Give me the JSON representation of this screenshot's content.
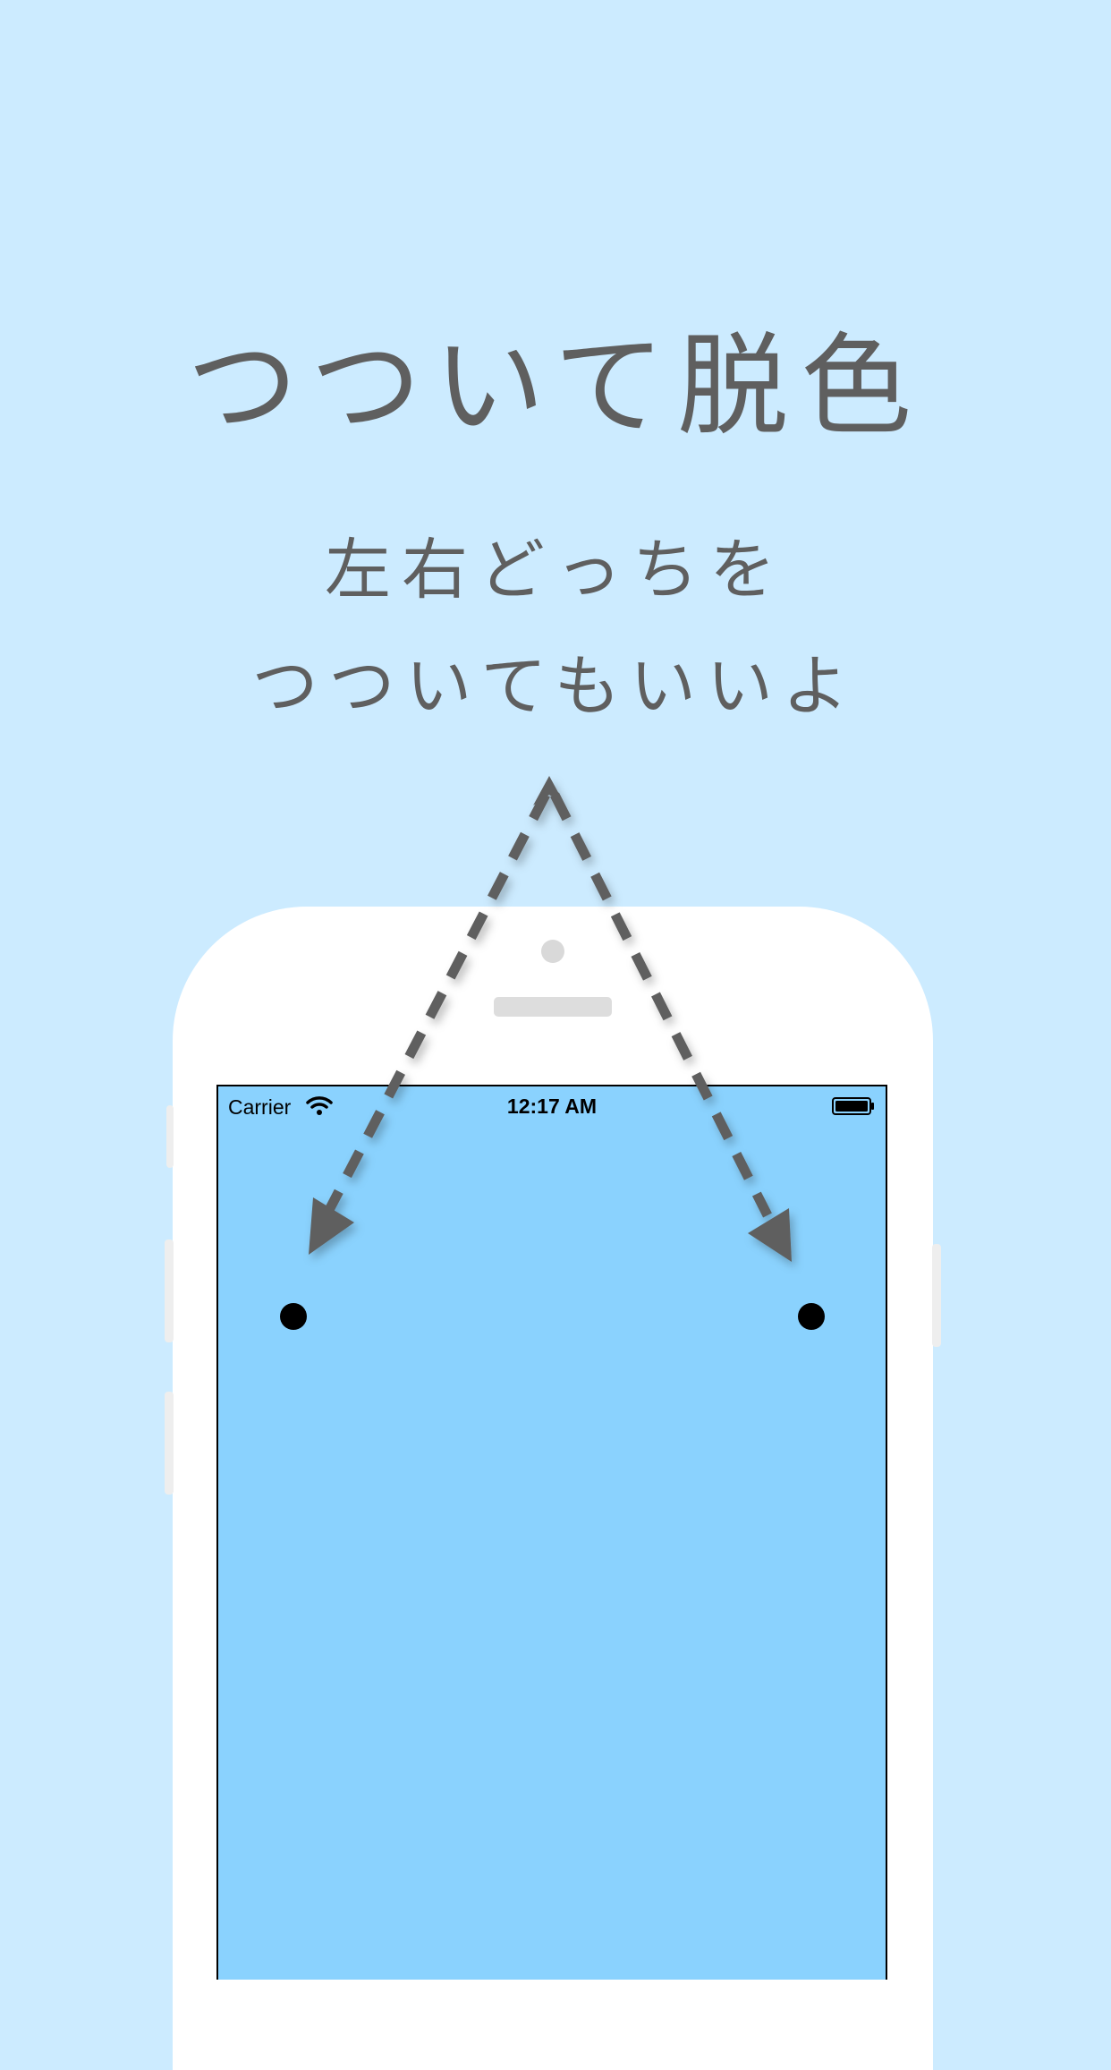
{
  "headline": {
    "title": "つついて脱色",
    "subtitle_line1": "左右どっちを",
    "subtitle_line2": "つついてもいいよ"
  },
  "status_bar": {
    "carrier": "Carrier",
    "time": "12:17 AM"
  },
  "colors": {
    "page_background": "#CCEBFF",
    "screen_background": "#8AD2FE",
    "text": "#5f5f5f",
    "arrow": "#5f5f5f",
    "dot": "#000000"
  },
  "icons": [
    "wifi-icon",
    "battery-icon",
    "dashed-arrow-left",
    "dashed-arrow-right"
  ]
}
